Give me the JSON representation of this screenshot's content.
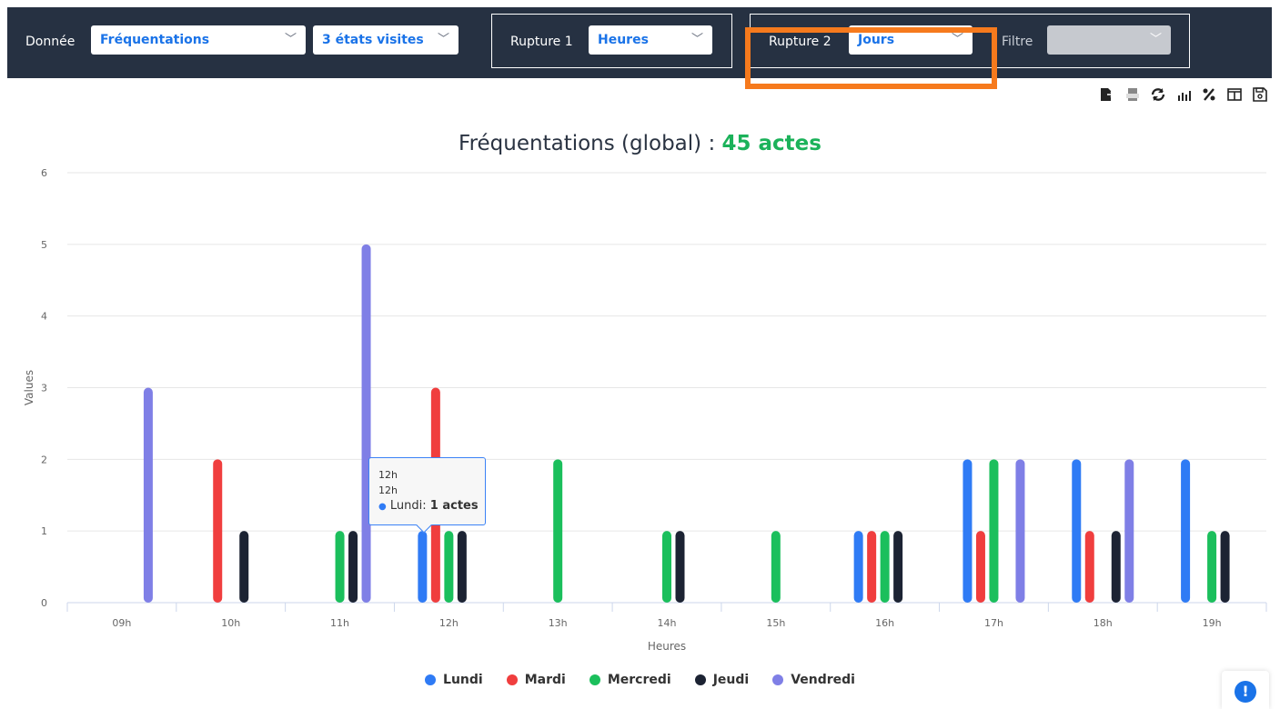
{
  "toolbar": {
    "donnee_label": "Donnée",
    "donnee_value": "Fréquentations",
    "etats_value": "3 états visites",
    "rupture1_label": "Rupture 1",
    "rupture1_value": "Heures",
    "rupture2_label": "Rupture 2",
    "rupture2_value": "Jours",
    "filtre_label": "Filtre",
    "filtre_value": ""
  },
  "icons": [
    "export-icon",
    "excel-icon",
    "refresh-icon",
    "bar-chart-icon",
    "percent-icon",
    "table-icon",
    "save-icon"
  ],
  "tooltip": {
    "line1": "12h",
    "line2": "12h",
    "series": "Lundi:",
    "value": "1 actes"
  },
  "help_icon": "help-icon",
  "chart_data": {
    "type": "bar",
    "title": "Fréquentations (global) :",
    "title_total": "45 actes",
    "xlabel": "Heures",
    "ylabel": "Values",
    "ylim": [
      0,
      6
    ],
    "yticks": [
      0,
      1,
      2,
      3,
      4,
      5,
      6
    ],
    "grid": true,
    "legend_position": "bottom",
    "categories": [
      "09h",
      "10h",
      "11h",
      "12h",
      "13h",
      "14h",
      "15h",
      "16h",
      "17h",
      "18h",
      "19h"
    ],
    "series": [
      {
        "name": "Lundi",
        "color": "#2f7bf5",
        "values": [
          0,
          0,
          0,
          1,
          0,
          0,
          0,
          1,
          2,
          2,
          2
        ]
      },
      {
        "name": "Mardi",
        "color": "#f03e3e",
        "values": [
          0,
          2,
          0,
          3,
          0,
          0,
          0,
          1,
          1,
          1,
          0
        ]
      },
      {
        "name": "Mercredi",
        "color": "#1bbf5c",
        "values": [
          0,
          0,
          1,
          1,
          2,
          1,
          1,
          1,
          2,
          0,
          1
        ]
      },
      {
        "name": "Jeudi",
        "color": "#1c2333",
        "values": [
          0,
          1,
          1,
          1,
          0,
          1,
          0,
          1,
          0,
          1,
          1
        ]
      },
      {
        "name": "Vendredi",
        "color": "#7f7fe6",
        "values": [
          3,
          0,
          5,
          0,
          0,
          0,
          0,
          0,
          2,
          2,
          0
        ]
      }
    ]
  }
}
